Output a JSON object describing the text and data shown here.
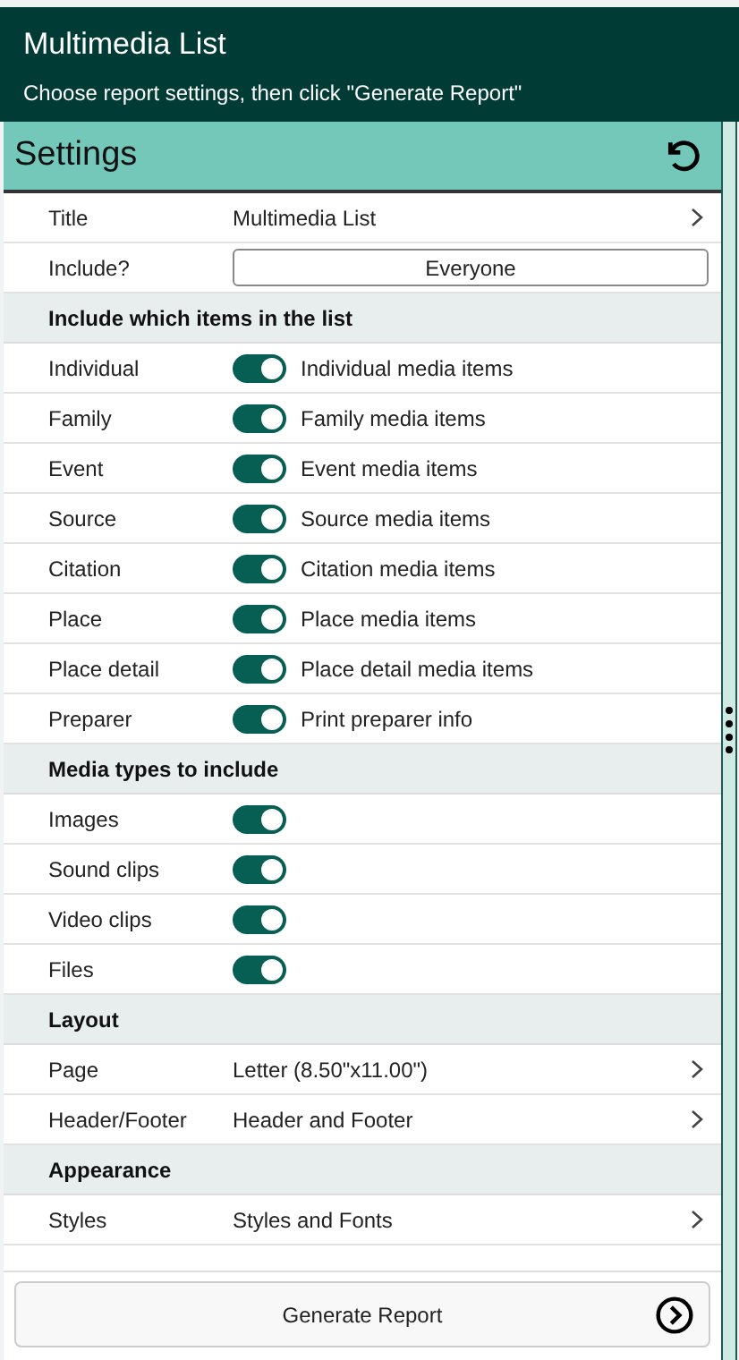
{
  "header": {
    "title": "Multimedia List",
    "subtitle": "Choose report settings, then click \"Generate Report\""
  },
  "settings": {
    "title": "Settings"
  },
  "rows": [
    {
      "kind": "link",
      "label": "Title",
      "value": "Multimedia List"
    },
    {
      "kind": "choice",
      "label": "Include?",
      "value": "Everyone"
    },
    {
      "kind": "section",
      "label": "Include which items in the list"
    },
    {
      "kind": "toggle",
      "label": "Individual",
      "on": true,
      "description": "Individual media items"
    },
    {
      "kind": "toggle",
      "label": "Family",
      "on": true,
      "description": "Family media items"
    },
    {
      "kind": "toggle",
      "label": "Event",
      "on": true,
      "description": "Event media items"
    },
    {
      "kind": "toggle",
      "label": "Source",
      "on": true,
      "description": "Source media items"
    },
    {
      "kind": "toggle",
      "label": "Citation",
      "on": true,
      "description": "Citation media items"
    },
    {
      "kind": "toggle",
      "label": "Place",
      "on": true,
      "description": "Place media items"
    },
    {
      "kind": "toggle",
      "label": "Place detail",
      "on": true,
      "description": "Place detail media items"
    },
    {
      "kind": "toggle",
      "label": "Preparer",
      "on": true,
      "description": "Print preparer info"
    },
    {
      "kind": "section",
      "label": "Media types to include"
    },
    {
      "kind": "toggle",
      "label": "Images",
      "on": true
    },
    {
      "kind": "toggle",
      "label": "Sound clips",
      "on": true
    },
    {
      "kind": "toggle",
      "label": "Video clips",
      "on": true
    },
    {
      "kind": "toggle",
      "label": "Files",
      "on": true
    },
    {
      "kind": "section",
      "label": "Layout"
    },
    {
      "kind": "link",
      "label": "Page",
      "value": "Letter (8.50\"x11.00\")"
    },
    {
      "kind": "link",
      "label": "Header/Footer",
      "value": "Header and Footer"
    },
    {
      "kind": "section",
      "label": "Appearance"
    },
    {
      "kind": "link",
      "label": "Styles",
      "value": "Styles and Fonts"
    }
  ],
  "generate_button": {
    "label": "Generate Report"
  }
}
